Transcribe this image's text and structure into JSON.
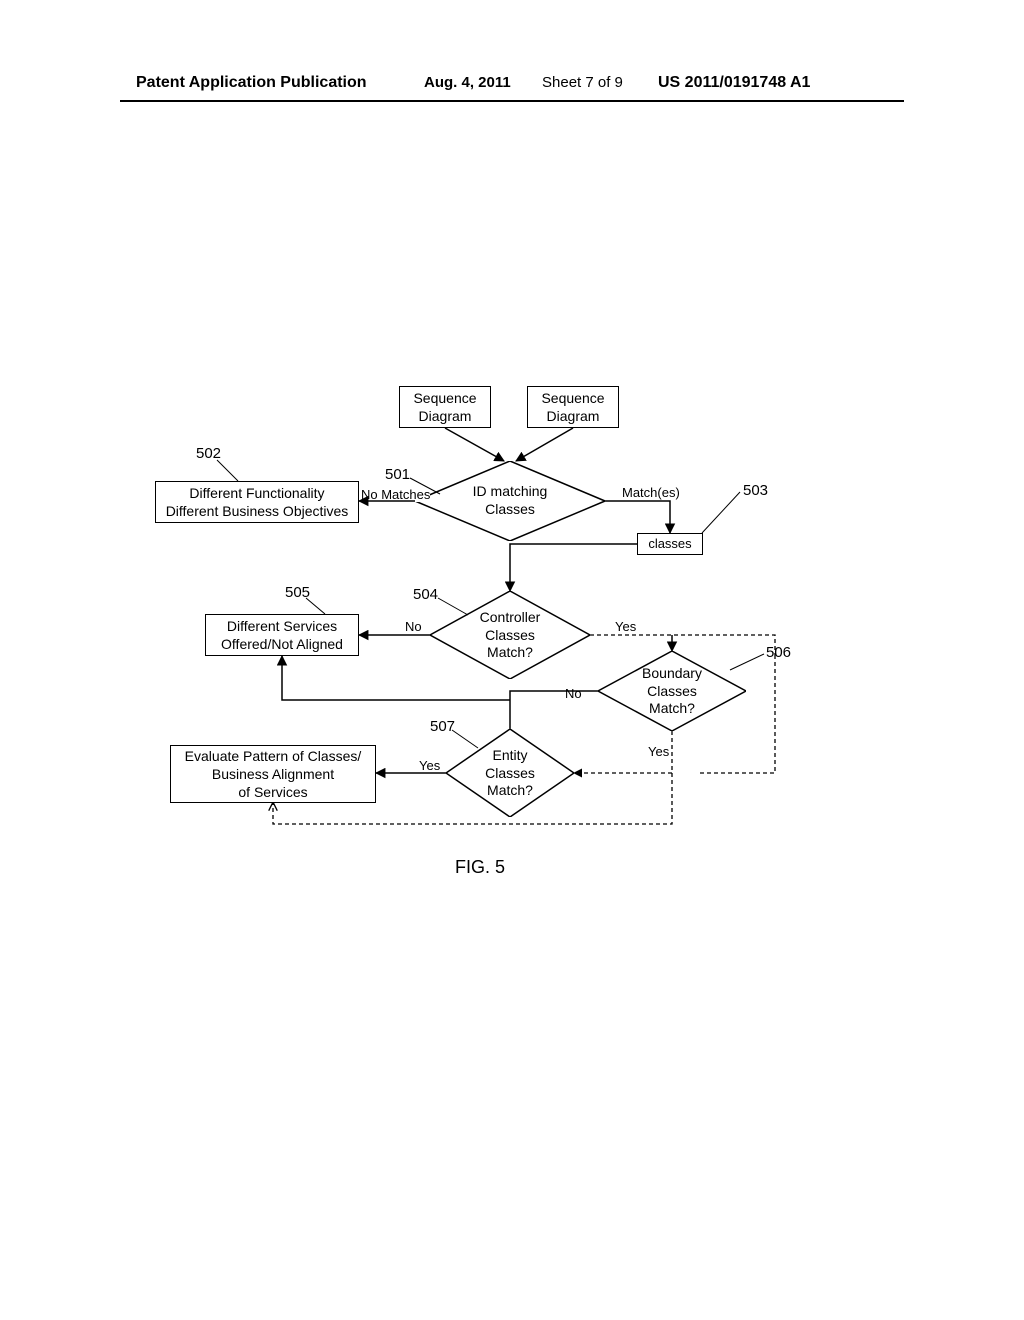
{
  "header": {
    "publication": "Patent Application Publication",
    "date": "Aug. 4, 2011",
    "sheet": "Sheet 7 of 9",
    "docnum": "US 2011/0191748 A1"
  },
  "nodes": {
    "seq1": "Sequence\nDiagram",
    "seq2": "Sequence\nDiagram",
    "d501": "ID matching\nClasses",
    "r502": "Different Functionality\nDifferent Business Objectives",
    "r503": "classes",
    "d504": "Controller\nClasses\nMatch?",
    "r505": "Different Services\nOffered/Not Aligned",
    "d506": "Boundary\nClasses\nMatch?",
    "d507": "Entity\nClasses\nMatch?",
    "r508": "Evaluate Pattern of Classes/\nBusiness Alignment\nof Services"
  },
  "refs": {
    "n501": "501",
    "n502": "502",
    "n503": "503",
    "n504": "504",
    "n505": "505",
    "n506": "506",
    "n507": "507"
  },
  "labels": {
    "noMatches": "No Matches",
    "matches": "Match(es)",
    "no504": "No",
    "yes504": "Yes",
    "no506": "No",
    "yes506": "Yes",
    "yes507": "Yes"
  },
  "figure": "FIG. 5"
}
